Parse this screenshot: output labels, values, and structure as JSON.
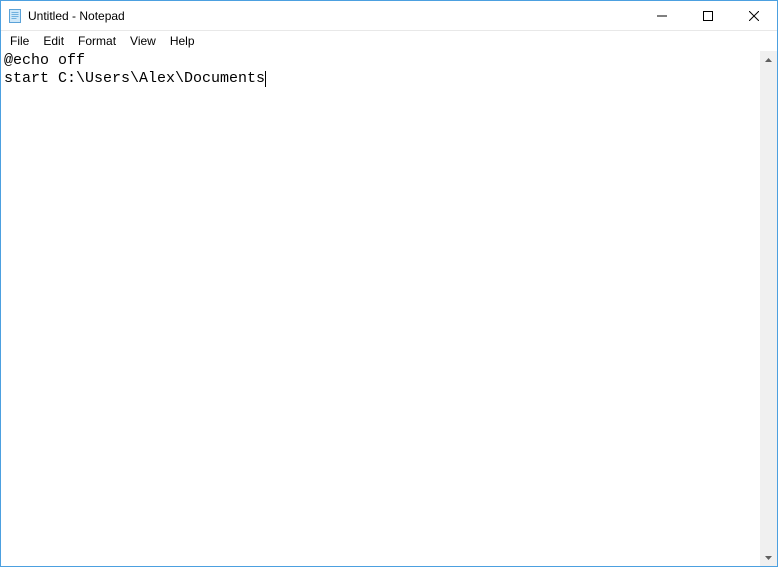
{
  "window": {
    "title": "Untitled - Notepad"
  },
  "menubar": {
    "items": [
      {
        "label": "File"
      },
      {
        "label": "Edit"
      },
      {
        "label": "Format"
      },
      {
        "label": "View"
      },
      {
        "label": "Help"
      }
    ]
  },
  "editor": {
    "content": "@echo off\nstart C:\\Users\\Alex\\Documents"
  }
}
